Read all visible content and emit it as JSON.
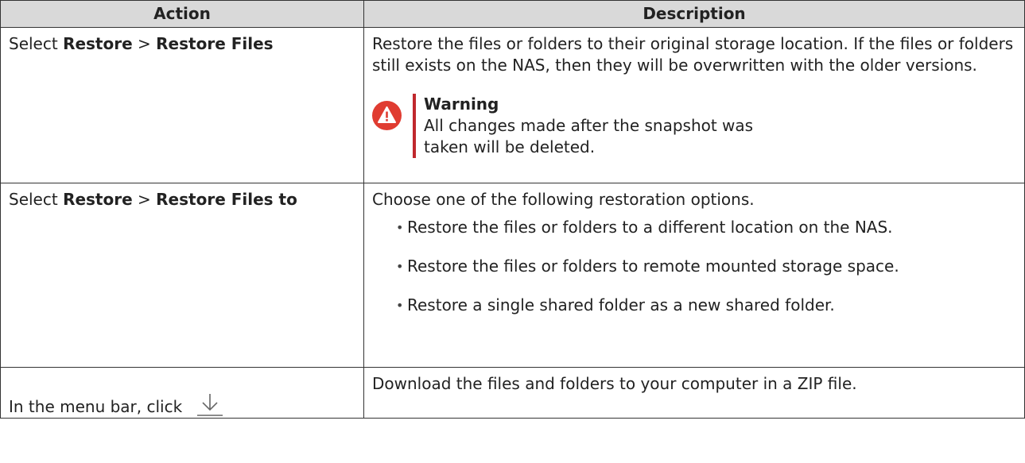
{
  "headers": {
    "action": "Action",
    "description": "Description"
  },
  "rows": [
    {
      "action": {
        "prefix": "Select ",
        "bold1": "Restore",
        "sep": " > ",
        "bold2": "Restore Files"
      },
      "description": "Restore the files or folders to their original storage location. If the files or folders still exists on the NAS, then they will be overwritten with the older versions.",
      "warning": {
        "title": "Warning",
        "text": "All changes made after the snapshot was taken will be deleted.",
        "icon": "warning-icon",
        "color": "#e03c31"
      }
    },
    {
      "action": {
        "prefix": "Select ",
        "bold1": "Restore",
        "sep": " > ",
        "bold2": "Restore Files to"
      },
      "description": "Choose one of the following restoration options.",
      "options": [
        "Restore the files or folders to a different location on the NAS.",
        "Restore the files or folders to remote mounted storage space.",
        "Restore a single shared folder as a new shared folder."
      ]
    },
    {
      "action": {
        "text": "In the menu bar, click",
        "icon": "download-icon"
      },
      "description": "Download the files and folders to your computer in a ZIP file."
    }
  ]
}
